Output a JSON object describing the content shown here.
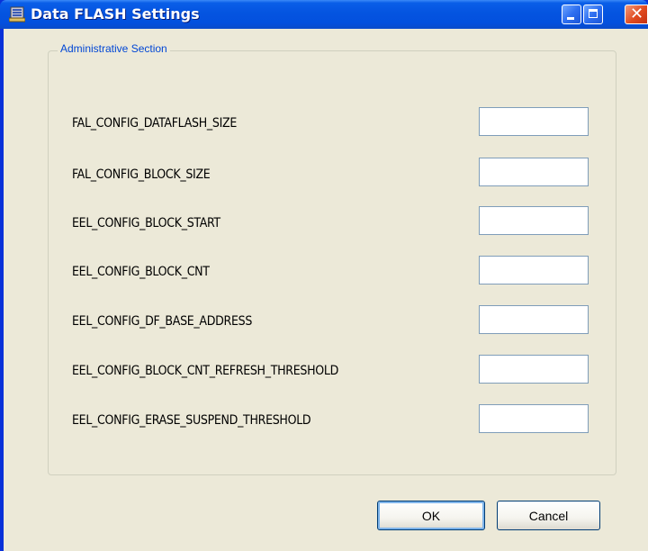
{
  "window": {
    "title": "Data FLASH Settings",
    "icon": "app-icon",
    "controls": {
      "minimize": "minimize-icon",
      "maximize": "maximize-icon",
      "close": "✕"
    }
  },
  "group": {
    "legend": "Administrative Section",
    "rows": [
      {
        "label": "FAL_CONFIG_DATAFLASH_SIZE",
        "value": ""
      },
      {
        "label": "FAL_CONFIG_BLOCK_SIZE",
        "value": ""
      },
      {
        "label": "EEL_CONFIG_BLOCK_START",
        "value": ""
      },
      {
        "label": "EEL_CONFIG_BLOCK_CNT",
        "value": ""
      },
      {
        "label": "EEL_CONFIG_DF_BASE_ADDRESS",
        "value": ""
      },
      {
        "label": "EEL_CONFIG_BLOCK_CNT_REFRESH_THRESHOLD",
        "value": ""
      },
      {
        "label": "EEL_CONFIG_ERASE_SUSPEND_THRESHOLD",
        "value": ""
      }
    ]
  },
  "buttons": {
    "ok": "OK",
    "cancel": "Cancel"
  },
  "colors": {
    "titlebar": "#0454e0",
    "client": "#ece9d8",
    "legend": "#0046d5",
    "input_border": "#7f9db9"
  }
}
